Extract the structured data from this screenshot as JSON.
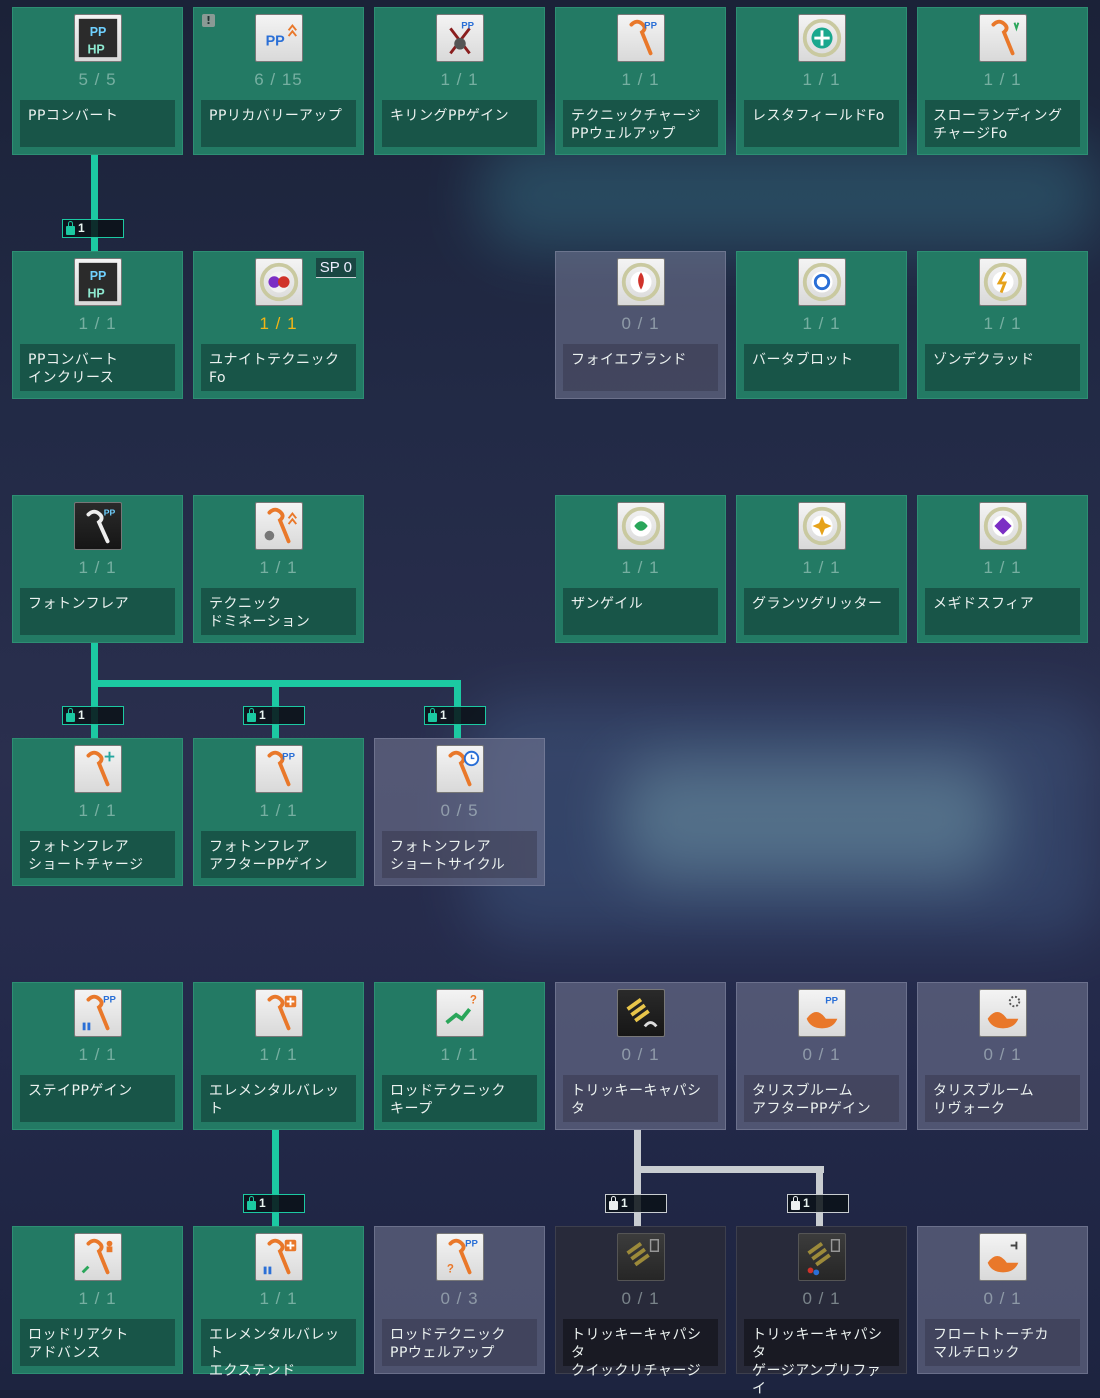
{
  "skills": [
    {
      "id": "r1c1",
      "name": "PPコンバート",
      "level": "5 / 5",
      "icon": "pp-hp-convert-icon",
      "state": "active"
    },
    {
      "id": "r1c2",
      "name": "PPリカバリーアップ",
      "level": "6 / 15",
      "icon": "pp-recovery-up-icon",
      "state": "active",
      "alert": "!"
    },
    {
      "id": "r1c3",
      "name": "キリングPPゲイン",
      "level": "1 / 1",
      "icon": "killing-pp-gain-icon",
      "state": "active"
    },
    {
      "id": "r1c4",
      "name": "テクニックチャージ\nPPウェルアップ",
      "level": "1 / 1",
      "icon": "rod-pp-icon",
      "state": "active"
    },
    {
      "id": "r1c5",
      "name": "レスタフィールドFo",
      "level": "1 / 1",
      "icon": "resta-field-icon",
      "state": "active"
    },
    {
      "id": "r1c6",
      "name": "スローランディング\nチャージFo",
      "level": "1 / 1",
      "icon": "slow-landing-icon",
      "state": "active"
    },
    {
      "id": "r2c1",
      "name": "PPコンバート\nインクリース",
      "level": "1 / 1",
      "icon": "pp-hp-convert-icon",
      "state": "active"
    },
    {
      "id": "r2c2",
      "name": "ユナイトテクニックFo",
      "level": "1 / 1",
      "icon": "unite-technique-icon",
      "state": "active learned",
      "sp": "SP 0"
    },
    {
      "id": "r2c4",
      "name": "フォイエブランド",
      "level": "0 / 1",
      "icon": "foie-brand-icon",
      "state": "inactive"
    },
    {
      "id": "r2c5",
      "name": "バータブロット",
      "level": "1 / 1",
      "icon": "barta-blot-icon",
      "state": "active"
    },
    {
      "id": "r2c6",
      "name": "ゾンデクラッド",
      "level": "1 / 1",
      "icon": "zonde-clad-icon",
      "state": "active"
    },
    {
      "id": "r3c1",
      "name": "フォトンフレア",
      "level": "1 / 1",
      "icon": "photon-flare-icon",
      "state": "active dark-icon"
    },
    {
      "id": "r3c2",
      "name": "テクニック\nドミネーション",
      "level": "1 / 1",
      "icon": "technique-domination-icon",
      "state": "active"
    },
    {
      "id": "r3c4",
      "name": "ザンゲイル",
      "level": "1 / 1",
      "icon": "zan-gale-icon",
      "state": "active"
    },
    {
      "id": "r3c5",
      "name": "グランツグリッター",
      "level": "1 / 1",
      "icon": "grants-glitter-icon",
      "state": "active"
    },
    {
      "id": "r3c6",
      "name": "メギドスフィア",
      "level": "1 / 1",
      "icon": "megid-sphere-icon",
      "state": "active"
    },
    {
      "id": "r4c1",
      "name": "フォトンフレア\nショートチャージ",
      "level": "1 / 1",
      "icon": "rod-sparkle-icon",
      "state": "active"
    },
    {
      "id": "r4c2",
      "name": "フォトンフレア\nアフターPPゲイン",
      "level": "1 / 1",
      "icon": "rod-pp-icon",
      "state": "active"
    },
    {
      "id": "r4c3",
      "name": "フォトンフレア\nショートサイクル",
      "level": "0 / 5",
      "icon": "rod-clock-icon",
      "state": "inactive"
    },
    {
      "id": "r5c1",
      "name": "ステイPPゲイン",
      "level": "1 / 1",
      "icon": "stay-pp-gain-icon",
      "state": "active"
    },
    {
      "id": "r5c2",
      "name": "エレメンタルバレット",
      "level": "1 / 1",
      "icon": "elemental-bullet-icon",
      "state": "active"
    },
    {
      "id": "r5c3",
      "name": "ロッドテクニック\nキープ",
      "level": "1 / 1",
      "icon": "rod-technique-keep-icon",
      "state": "active"
    },
    {
      "id": "r5c4",
      "name": "トリッキーキャパシタ",
      "level": "0 / 1",
      "icon": "tricky-capacitor-icon",
      "state": "inactive dark-icon"
    },
    {
      "id": "r5c5",
      "name": "タリスブルーム\nアフターPPゲイン",
      "level": "0 / 1",
      "icon": "talis-bloom-pp-icon",
      "state": "inactive"
    },
    {
      "id": "r5c6",
      "name": "タリスブルーム\nリヴォーク",
      "level": "0 / 1",
      "icon": "talis-bloom-revoke-icon",
      "state": "inactive"
    },
    {
      "id": "r6c1",
      "name": "ロッドリアクト\nアドバンス",
      "level": "1 / 1",
      "icon": "rod-react-icon",
      "state": "active"
    },
    {
      "id": "r6c2",
      "name": "エレメンタルバレット\nエクステンド",
      "level": "1 / 1",
      "icon": "elemental-bullet-extend-icon",
      "state": "active"
    },
    {
      "id": "r6c3",
      "name": "ロッドテクニック\nPPウェルアップ",
      "level": "0 / 3",
      "icon": "rod-technique-pp-icon",
      "state": "inactive"
    },
    {
      "id": "r6c4",
      "name": "トリッキーキャパシタ\nクイックリチャージ",
      "level": "0 / 1",
      "icon": "tricky-capacitor-recharge-icon",
      "state": "locked"
    },
    {
      "id": "r6c5",
      "name": "トリッキーキャパシタ\nゲージアンプリファイ",
      "level": "0 / 1",
      "icon": "tricky-capacitor-amplify-icon",
      "state": "locked"
    },
    {
      "id": "r6c6",
      "name": "フロートトーチカ\nマルチロック",
      "level": "0 / 1",
      "icon": "float-torchka-icon",
      "state": "inactive"
    }
  ],
  "locks": [
    {
      "id": "l1",
      "count": "1",
      "style": "teal"
    },
    {
      "id": "l2",
      "count": "1",
      "style": "teal"
    },
    {
      "id": "l3",
      "count": "1",
      "style": "teal"
    },
    {
      "id": "l4",
      "count": "1",
      "style": "teal"
    },
    {
      "id": "l5",
      "count": "1",
      "style": "teal"
    },
    {
      "id": "l6",
      "count": "1",
      "style": "gray"
    },
    {
      "id": "l7",
      "count": "1",
      "style": "gray"
    }
  ],
  "colors": {
    "accent": "#1cc9a2",
    "learned": "#f2b515",
    "card_active": "#237a64"
  }
}
